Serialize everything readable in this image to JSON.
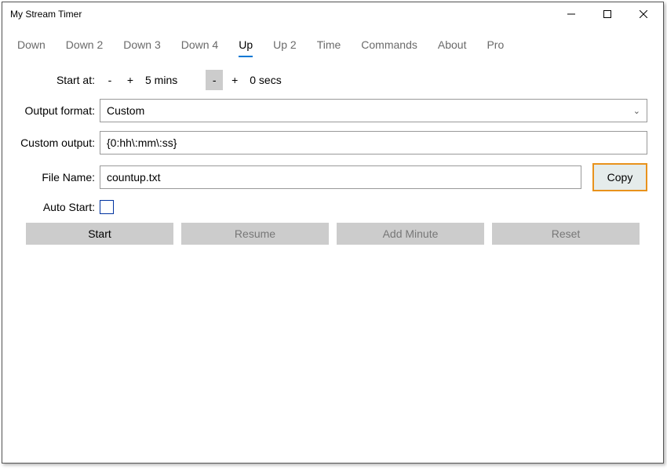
{
  "window": {
    "title": "My Stream Timer"
  },
  "tabs": [
    {
      "label": "Down",
      "active": false
    },
    {
      "label": "Down 2",
      "active": false
    },
    {
      "label": "Down 3",
      "active": false
    },
    {
      "label": "Down 4",
      "active": false
    },
    {
      "label": "Up",
      "active": true
    },
    {
      "label": "Up 2",
      "active": false
    },
    {
      "label": "Time",
      "active": false
    },
    {
      "label": "Commands",
      "active": false
    },
    {
      "label": "About",
      "active": false
    },
    {
      "label": "Pro",
      "active": false
    }
  ],
  "labels": {
    "start_at": "Start at:",
    "output_format": "Output format:",
    "custom_output": "Custom output:",
    "file_name": "File Name:",
    "auto_start": "Auto Start:"
  },
  "stepper": {
    "minus": "-",
    "plus": "+",
    "mins_value": "5 mins",
    "secs_value": "0 secs"
  },
  "output_format": {
    "selected": "Custom"
  },
  "custom_output": {
    "value": "{0:hh\\:mm\\:ss}"
  },
  "file_name": {
    "value": "countup.txt"
  },
  "copy_button": "Copy",
  "auto_start_checked": false,
  "action_buttons": {
    "start": "Start",
    "resume": "Resume",
    "add_minute": "Add Minute",
    "reset": "Reset"
  }
}
